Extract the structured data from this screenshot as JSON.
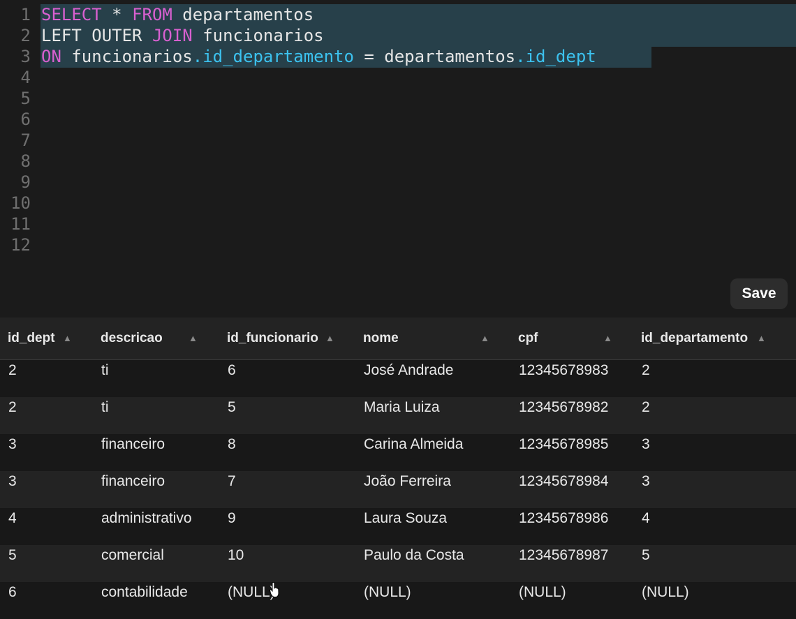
{
  "editor": {
    "line_numbers": [
      "1",
      "2",
      "3",
      "4",
      "5",
      "6",
      "7",
      "8",
      "9",
      "10",
      "11",
      "12"
    ],
    "lines": [
      [
        {
          "t": "SELECT",
          "c": "kw"
        },
        {
          "t": " * ",
          "c": ""
        },
        {
          "t": "FROM",
          "c": "kw"
        },
        {
          "t": " departamentos",
          "c": ""
        }
      ],
      [
        {
          "t": "LEFT OUTER ",
          "c": ""
        },
        {
          "t": "JOIN",
          "c": "kw"
        },
        {
          "t": " funcionarios",
          "c": ""
        }
      ],
      [
        {
          "t": "ON",
          "c": "kw"
        },
        {
          "t": " funcionarios",
          "c": ""
        },
        {
          "t": ".id_departamento",
          "c": "col"
        },
        {
          "t": " = departamentos",
          "c": ""
        },
        {
          "t": ".id_dept",
          "c": "col"
        }
      ]
    ],
    "save_label": "Save"
  },
  "table": {
    "columns": [
      "id_dept",
      "descricao",
      "id_funcionario",
      "nome",
      "cpf",
      "id_departamento"
    ],
    "rows": [
      [
        "2",
        "ti",
        "6",
        "José Andrade",
        "12345678983",
        "2"
      ],
      [
        "2",
        "ti",
        "5",
        "Maria Luiza",
        "12345678982",
        "2"
      ],
      [
        "3",
        "financeiro",
        "8",
        "Carina Almeida",
        "12345678985",
        "3"
      ],
      [
        "3",
        "financeiro",
        "7",
        "João Ferreira",
        "12345678984",
        "3"
      ],
      [
        "4",
        "administrativo",
        "9",
        "Laura Souza",
        "12345678986",
        "4"
      ],
      [
        "5",
        "comercial",
        "10",
        "Paulo da Costa",
        "12345678987",
        "5"
      ],
      [
        "6",
        "contabilidade",
        "(NULL)",
        "(NULL)",
        "(NULL)",
        "(NULL)"
      ]
    ]
  },
  "icons": {
    "sort": "sort-ascending-icon",
    "cursor": "hand-pointer-icon"
  }
}
